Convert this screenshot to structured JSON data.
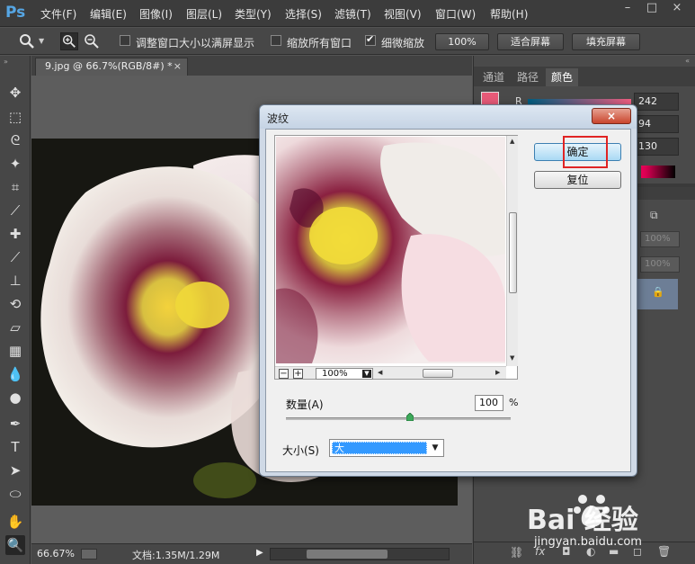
{
  "app": {
    "logo": "Ps"
  },
  "menubar": {
    "items": [
      "文件(F)",
      "编辑(E)",
      "图像(I)",
      "图层(L)",
      "类型(Y)",
      "选择(S)",
      "滤镜(T)",
      "视图(V)",
      "窗口(W)",
      "帮助(H)"
    ],
    "window_controls": [
      "–",
      "□",
      "×"
    ]
  },
  "options": {
    "resize_windows_label": "调整窗口大小以满屏显示",
    "resize_windows_checked": false,
    "zoom_all_label": "缩放所有窗口",
    "zoom_all_checked": false,
    "scrubby_zoom_label": "细微缩放",
    "scrubby_zoom_checked": true,
    "actual_pixels_btn": "100%",
    "fit_screen_btn": "适合屏幕",
    "fill_screen_btn": "填充屏幕"
  },
  "toolbar": {
    "icons": [
      "move-icon",
      "marquee-icon",
      "lasso-icon",
      "magic-wand-icon",
      "crop-icon",
      "eyedropper-icon",
      "healing-icon",
      "brush-icon",
      "clone-stamp-icon",
      "history-brush-icon",
      "eraser-icon",
      "gradient-icon",
      "blur-icon",
      "dodge-icon",
      "pen-icon",
      "type-icon",
      "path-select-icon",
      "shape-icon",
      "hand-icon",
      "zoom-icon"
    ]
  },
  "document": {
    "tab_title": "9.jpg @ 66.7%(RGB/8#) *",
    "tab_close": "×"
  },
  "status": {
    "zoom": "66.67%",
    "doc_info": "文档:1.35M/1.29M"
  },
  "panel": {
    "tabs": [
      "通道",
      "路径",
      "颜色"
    ],
    "active_tab": "颜色",
    "r_label": "R",
    "r_value": "242",
    "g_value": "94",
    "b_value": "130",
    "opacity_1": "100%",
    "opacity_2": "100%"
  },
  "dialog": {
    "title": "波纹",
    "close": "×",
    "ok_label": "确定",
    "reset_label": "复位",
    "zoom_value": "100%",
    "zoom_out": "−",
    "zoom_in": "+",
    "amount_label": "数量(A)",
    "amount_value": "100",
    "amount_unit": "%",
    "amount_fraction": 0.55,
    "size_label": "大小(S)",
    "size_value": "大"
  },
  "watermark": {
    "brand": "Bai  经验",
    "url": "jingyan.baidu.com"
  },
  "colors": {
    "foreground": "#e75a78",
    "ok_highlight": "#e02424"
  }
}
